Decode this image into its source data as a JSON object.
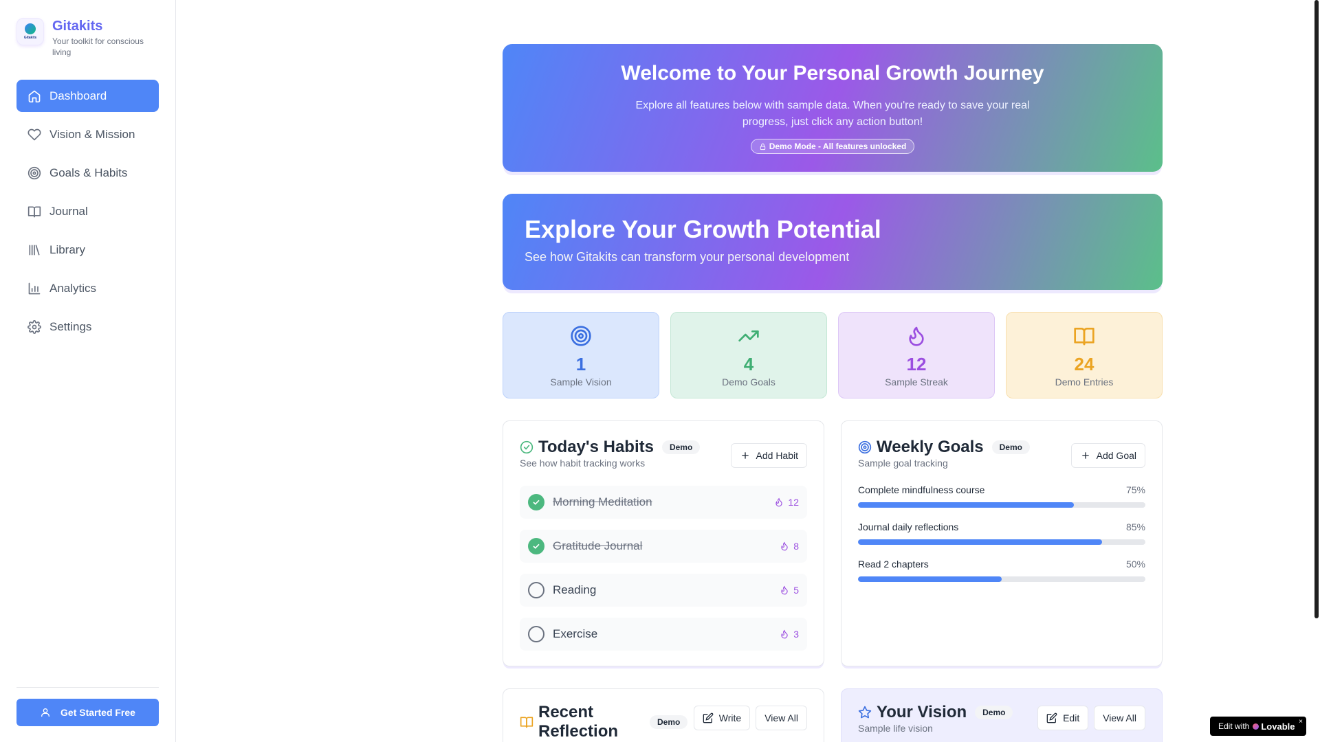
{
  "brand": {
    "name": "Gitakits",
    "tagline": "Your toolkit for conscious living",
    "logo_text": "Gitakits"
  },
  "nav": [
    {
      "label": "Dashboard",
      "icon": "home-icon",
      "active": true
    },
    {
      "label": "Vision & Mission",
      "icon": "heart-icon"
    },
    {
      "label": "Goals & Habits",
      "icon": "target-icon"
    },
    {
      "label": "Journal",
      "icon": "book-icon"
    },
    {
      "label": "Library",
      "icon": "library-icon"
    },
    {
      "label": "Analytics",
      "icon": "bar-chart-icon"
    },
    {
      "label": "Settings",
      "icon": "gear-icon"
    }
  ],
  "sidebar_cta": {
    "label": "Get Started Free"
  },
  "welcome": {
    "title": "Welcome to Your Personal Growth Journey",
    "text": "Explore all features below with sample data. When you're ready to save your real progress, just click any action button!",
    "pill": "Demo Mode - All features unlocked"
  },
  "explore": {
    "title": "Explore Your Growth Potential",
    "subtitle": "See how Gitakits can transform your personal development"
  },
  "stats": [
    {
      "value": "1",
      "label": "Sample Vision",
      "icon": "target-icon",
      "color": "#3b6fe0"
    },
    {
      "value": "4",
      "label": "Demo Goals",
      "icon": "trending-up-icon",
      "color": "#3fae73"
    },
    {
      "value": "12",
      "label": "Sample Streak",
      "icon": "flame-icon",
      "color": "#9b4ee0"
    },
    {
      "value": "24",
      "label": "Demo Entries",
      "icon": "book-icon",
      "color": "#eba423"
    }
  ],
  "habits_card": {
    "title": "Today's Habits",
    "badge": "Demo",
    "subtitle": "See how habit tracking works",
    "button": "Add Habit",
    "items": [
      {
        "name": "Morning Meditation",
        "streak": "12",
        "done": true
      },
      {
        "name": "Gratitude Journal",
        "streak": "8",
        "done": true
      },
      {
        "name": "Reading",
        "streak": "5",
        "done": false
      },
      {
        "name": "Exercise",
        "streak": "3",
        "done": false
      }
    ]
  },
  "goals_card": {
    "title": "Weekly Goals",
    "badge": "Demo",
    "subtitle": "Sample goal tracking",
    "button": "Add Goal",
    "items": [
      {
        "name": "Complete mindfulness course",
        "pct_label": "75%",
        "progress": 75
      },
      {
        "name": "Journal daily reflections",
        "pct_label": "85%",
        "progress": 85
      },
      {
        "name": "Read 2 chapters",
        "pct_label": "50%",
        "progress": 50
      }
    ]
  },
  "reflection_card": {
    "title": "Recent Reflection",
    "badge": "Demo",
    "write": "Write",
    "view_all": "View All"
  },
  "vision_card": {
    "title": "Your Vision",
    "badge": "Demo",
    "subtitle": "Sample life vision",
    "edit": "Edit",
    "view_all": "View All"
  },
  "lovable": {
    "prefix": "Edit with",
    "brand": "Lovable",
    "close": "×"
  }
}
